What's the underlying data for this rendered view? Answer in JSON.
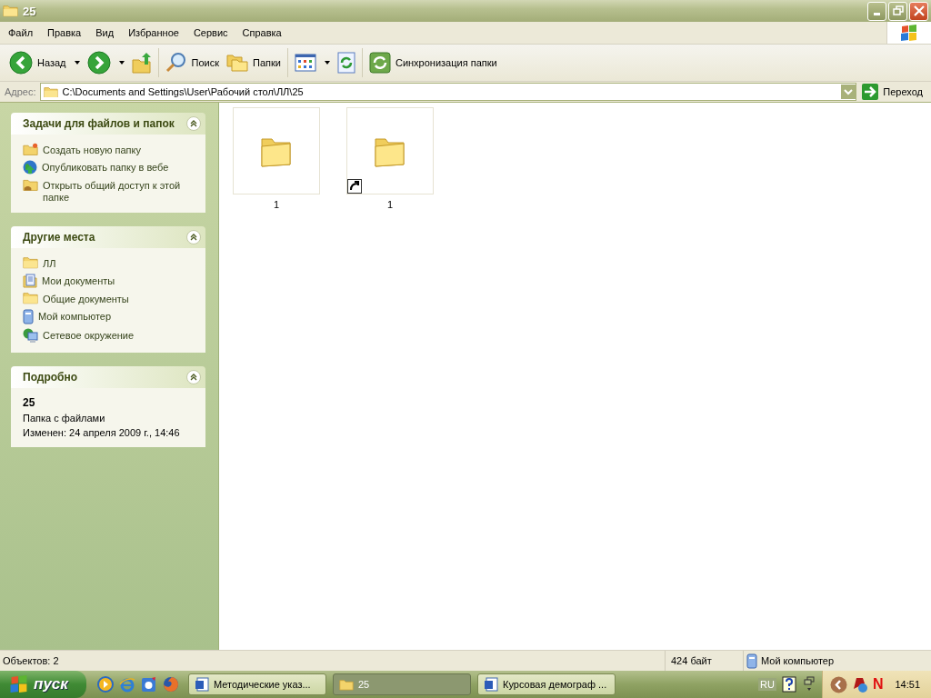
{
  "window": {
    "title": "25"
  },
  "menu": [
    "Файл",
    "Правка",
    "Вид",
    "Избранное",
    "Сервис",
    "Справка"
  ],
  "toolbar": [
    {
      "label": "Назад",
      "dropdown": true
    },
    {
      "dropdown": true
    },
    {
      "dropdown": false
    },
    {
      "label": "Поиск",
      "dropdown": false
    },
    {
      "label": "Папки",
      "dropdown": false
    },
    {
      "dropdown": true
    },
    {
      "dropdown": false
    },
    {
      "label": "Синхронизация папки",
      "dropdown": false
    }
  ],
  "address": {
    "label": "Адрес:",
    "value": "C:\\Documents and Settings\\User\\Рабочий стол\\ЛЛ\\25",
    "go": "Переход"
  },
  "sidebar": {
    "tasks": {
      "title": "Задачи для файлов и папок",
      "items": [
        "Создать новую папку",
        "Опубликовать папку в вебе",
        "Открыть общий доступ к этой папке"
      ]
    },
    "places": {
      "title": "Другие места",
      "items": [
        "ЛЛ",
        "Мои документы",
        "Общие документы",
        "Мой компьютер",
        "Сетевое окружение"
      ]
    },
    "details": {
      "title": "Подробно",
      "name": "25",
      "type": "Папка с файлами",
      "modified": "Изменен: 24 апреля 2009 г., 14:46"
    }
  },
  "files": [
    {
      "name": "1",
      "shortcut": false
    },
    {
      "name": "1",
      "shortcut": true
    }
  ],
  "status_bar": {
    "objects": "Объектов: 2",
    "size": "424 байт",
    "location": "Мой компьютер"
  },
  "taskbar": {
    "start": "пуск",
    "buttons": [
      {
        "label": "Методические указ...",
        "selected": false
      },
      {
        "label": "25",
        "selected": true
      },
      {
        "label": "Курсовая демограф ...",
        "selected": false
      }
    ],
    "tray": {
      "language": "RU",
      "letter": "N",
      "clock": "14:51"
    }
  }
}
